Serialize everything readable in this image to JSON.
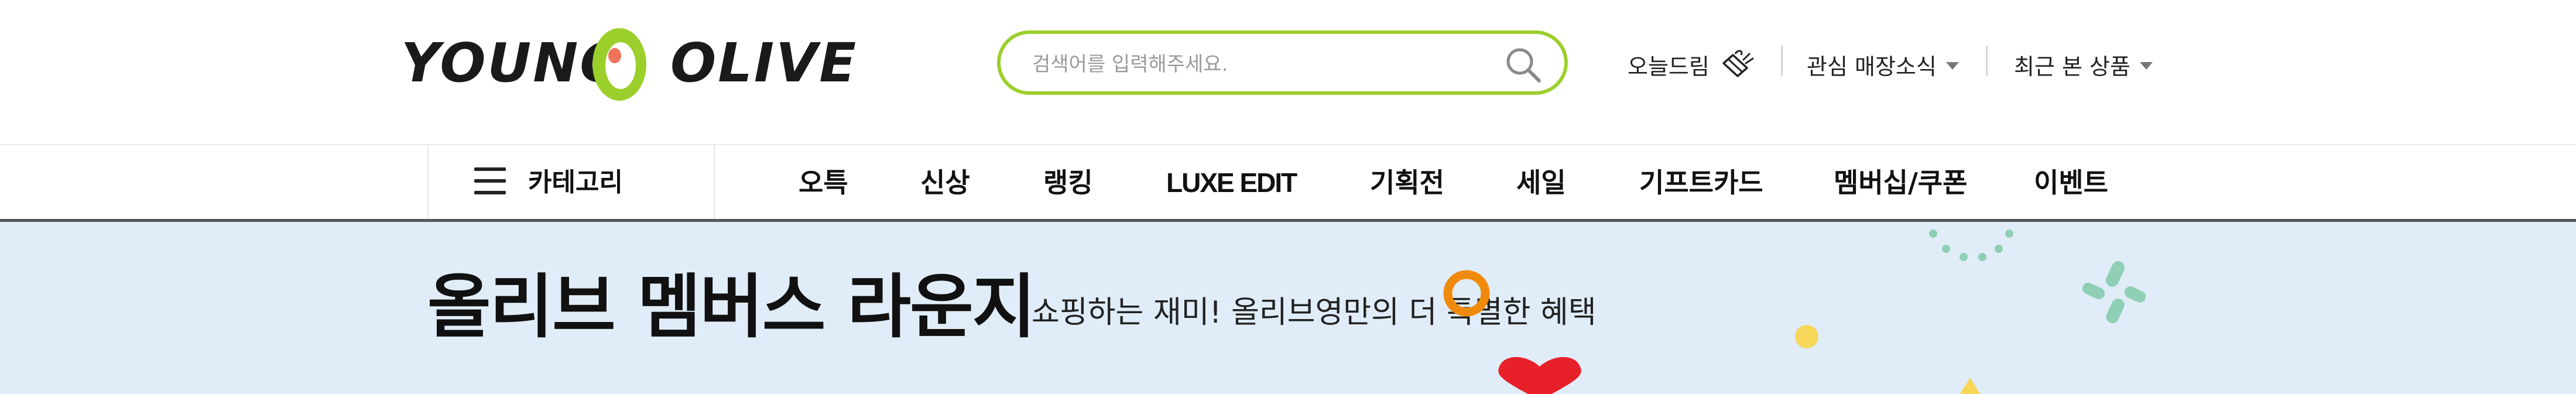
{
  "logo": {
    "left_word": "YOUNG",
    "right_word": "OLIVE"
  },
  "search": {
    "placeholder": "검색어를 입력해주세요."
  },
  "utility": {
    "today_dream": "오늘드림",
    "favorite_store_news": "관심 매장소식",
    "recent_products": "최근 본 상품"
  },
  "nav": {
    "category_label": "카테고리",
    "menu": [
      "오특",
      "신상",
      "랭킹",
      "LUXE EDIT",
      "기획전",
      "세일",
      "기프트카드",
      "멤버십/쿠폰",
      "이벤트"
    ]
  },
  "banner": {
    "title": "올리브 멤버스 라운지",
    "subtitle": "쇼핑하는 재미! 올리브영만의 더 특별한 혜택"
  },
  "colors": {
    "brand_green": "#9bcf2b",
    "banner_bg": "#e0edf8",
    "deco_orange": "#f08a0c",
    "deco_red": "#e8202a",
    "deco_yellow": "#f7d65a",
    "deco_mint": "#8fcfb5"
  }
}
